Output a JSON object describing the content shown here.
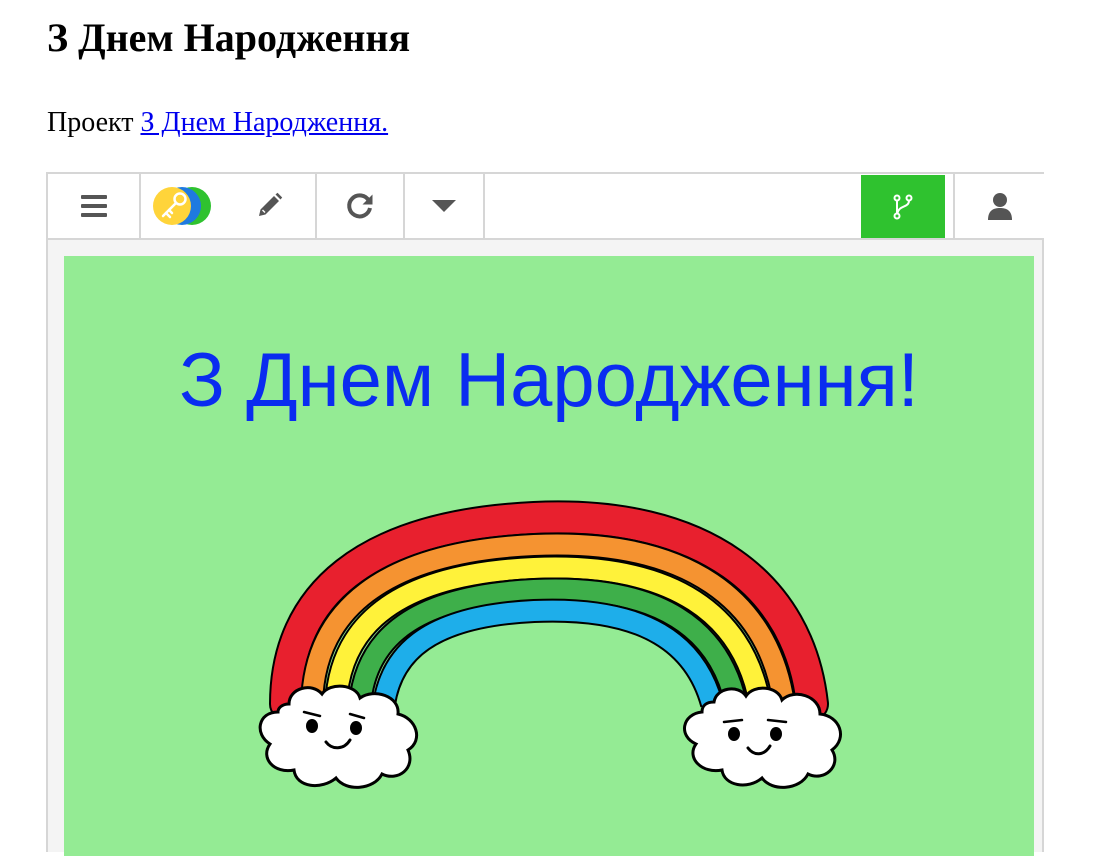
{
  "page": {
    "title": "З Днем Народження",
    "intro_prefix": "Проект ",
    "intro_link": "З Днем Народження."
  },
  "toolbar": {
    "icons": [
      "menu-icon",
      "key-icon",
      "pencil-icon",
      "reload-icon",
      "dropdown-caret-icon",
      "branch-icon",
      "user-icon"
    ],
    "remix_color": "#2fc22f"
  },
  "stage": {
    "greeting": "З Днем Народження!",
    "background": "#94eb94",
    "text_color": "#0a2cf0",
    "rainbow_colors": [
      "#e8202e",
      "#f59331",
      "#fff23a",
      "#3eaf4a",
      "#1eaeea"
    ]
  }
}
